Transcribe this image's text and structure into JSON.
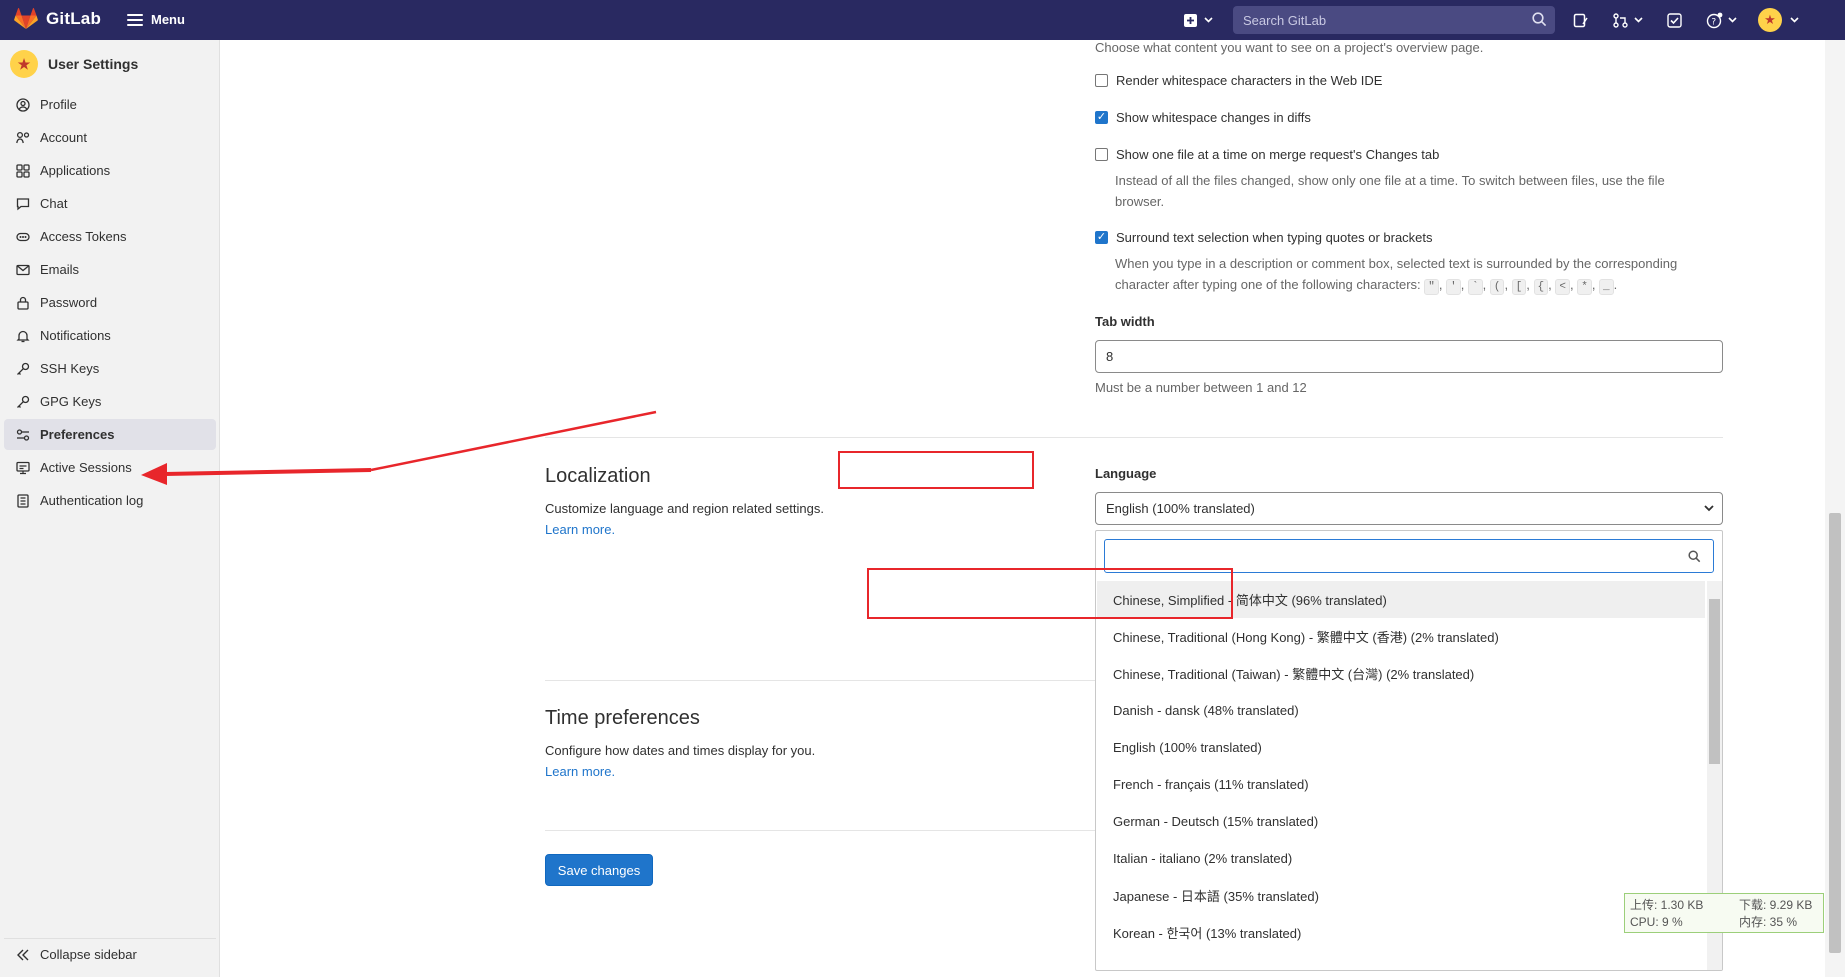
{
  "topbar": {
    "brand": "GitLab",
    "menu_label": "Menu",
    "search_placeholder": "Search GitLab"
  },
  "sidebar": {
    "title": "User Settings",
    "items": [
      {
        "label": "Profile",
        "icon": "profile-icon"
      },
      {
        "label": "Account",
        "icon": "account-icon"
      },
      {
        "label": "Applications",
        "icon": "applications-icon"
      },
      {
        "label": "Chat",
        "icon": "chat-icon"
      },
      {
        "label": "Access Tokens",
        "icon": "token-icon"
      },
      {
        "label": "Emails",
        "icon": "email-icon"
      },
      {
        "label": "Password",
        "icon": "lock-icon"
      },
      {
        "label": "Notifications",
        "icon": "bell-icon"
      },
      {
        "label": "SSH Keys",
        "icon": "key-icon"
      },
      {
        "label": "GPG Keys",
        "icon": "key-icon"
      },
      {
        "label": "Preferences",
        "icon": "preferences-icon",
        "active": true
      },
      {
        "label": "Active Sessions",
        "icon": "monitor-icon"
      },
      {
        "label": "Authentication log",
        "icon": "log-icon"
      }
    ],
    "collapse_label": "Collapse sidebar"
  },
  "behavior": {
    "overview_help": "Choose what content you want to see on a project's overview page.",
    "whitespace_ide": {
      "label": "Render whitespace characters in the Web IDE",
      "checked": false
    },
    "whitespace_diffs": {
      "label": "Show whitespace changes in diffs",
      "checked": true
    },
    "one_file": {
      "label": "Show one file at a time on merge request's Changes tab",
      "checked": false,
      "help_line1": "Instead of all the files changed, show only one file at a time. To switch between files, use the file",
      "help_line2": "browser."
    },
    "surround": {
      "label": "Surround text selection when typing quotes or brackets",
      "checked": true,
      "help_line1": "When you type in a description or comment box, selected text is surrounded by the corresponding",
      "help_line2_prefix": "character after typing one of the following characters:",
      "chars": [
        "\"",
        "'",
        "`",
        "(",
        "[",
        "{",
        "<",
        "*",
        "_"
      ]
    },
    "tab_width": {
      "label": "Tab width",
      "value": "8",
      "help": "Must be a number between 1 and 12"
    }
  },
  "localization": {
    "title": "Localization",
    "description": "Customize language and region related settings.",
    "learn_more": "Learn more.",
    "language_label": "Language",
    "selected_language": "English (100% translated)",
    "options": [
      "Chinese, Simplified - 简体中文 (96% translated)",
      "Chinese, Traditional (Hong Kong) - 繁體中文 (香港) (2% translated)",
      "Chinese, Traditional (Taiwan) - 繁體中文 (台灣) (2% translated)",
      "Danish - dansk (48% translated)",
      "English (100% translated)",
      "French - français (11% translated)",
      "German - Deutsch (15% translated)",
      "Italian - italiano (2% translated)",
      "Japanese - 日本語 (35% translated)",
      "Korean - 한국어 (13% translated)"
    ]
  },
  "time_preferences": {
    "title": "Time preferences",
    "description": "Configure how dates and times display for you.",
    "learn_more": "Learn more."
  },
  "actions": {
    "save_label": "Save changes"
  },
  "netmon": {
    "upload": "上传: 1.30 KB",
    "download": "下载: 9.29 KB",
    "cpu": "CPU: 9 %",
    "memory": "内存: 35 %"
  },
  "colors": {
    "topbar": "#292961",
    "accent": "#1f75cb",
    "annotation": "#e8262b"
  }
}
